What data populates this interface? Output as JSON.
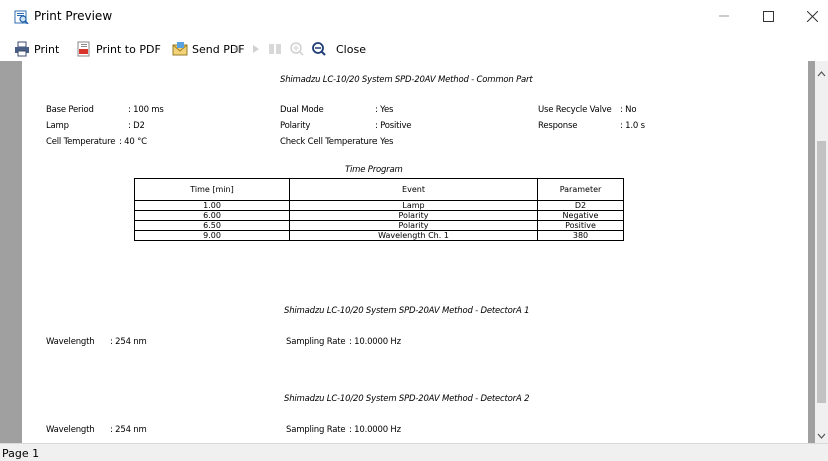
{
  "window": {
    "title": "Print Preview"
  },
  "toolbar": {
    "print": "Print",
    "print_pdf": "Print to PDF",
    "send_pdf": "Send PDF",
    "close": "Close"
  },
  "report": {
    "common_title": "Shimadzu LC-10/20 System SPD-20AV Method - Common Part",
    "common_fields": {
      "base_period_label": "Base Period",
      "base_period_value": ": 100 ms",
      "lamp_label": "Lamp",
      "lamp_value": ": D2",
      "cell_temp_label": "Cell Temperature",
      "cell_temp_value": ": 40 °C",
      "dual_mode_label": "Dual Mode",
      "dual_mode_value": ": Yes",
      "polarity_label": "Polarity",
      "polarity_value": ": Positive",
      "check_cell_label": "Check Cell Temperature",
      "check_cell_value": ": Yes",
      "recycle_label": "Use Recycle Valve",
      "recycle_value": ": No",
      "response_label": "Response",
      "response_value": ": 1.0 s"
    },
    "time_program": {
      "title": "Time Program",
      "headers": [
        "Time [min]",
        "Event",
        "Parameter"
      ],
      "rows": [
        [
          "1.00",
          "Lamp",
          "D2"
        ],
        [
          "6.00",
          "Polarity",
          "Negative"
        ],
        [
          "6.50",
          "Polarity",
          "Positive"
        ],
        [
          "9.00",
          "Wavelength Ch. 1",
          "380"
        ]
      ]
    },
    "detector_a1": {
      "title": "Shimadzu LC-10/20 System SPD-20AV Method - DetectorA 1",
      "wavelength_label": "Wavelength",
      "wavelength_value": ": 254 nm",
      "sampling_label": "Sampling Rate",
      "sampling_value": ": 10.0000 Hz"
    },
    "detector_a2": {
      "title": "Shimadzu LC-10/20 System SPD-20AV Method - DetectorA 2",
      "wavelength_label": "Wavelength",
      "wavelength_value": ": 254 nm",
      "sampling_label": "Sampling Rate",
      "sampling_value": ": 10.0000 Hz"
    }
  },
  "status": {
    "page": "Page 1"
  }
}
